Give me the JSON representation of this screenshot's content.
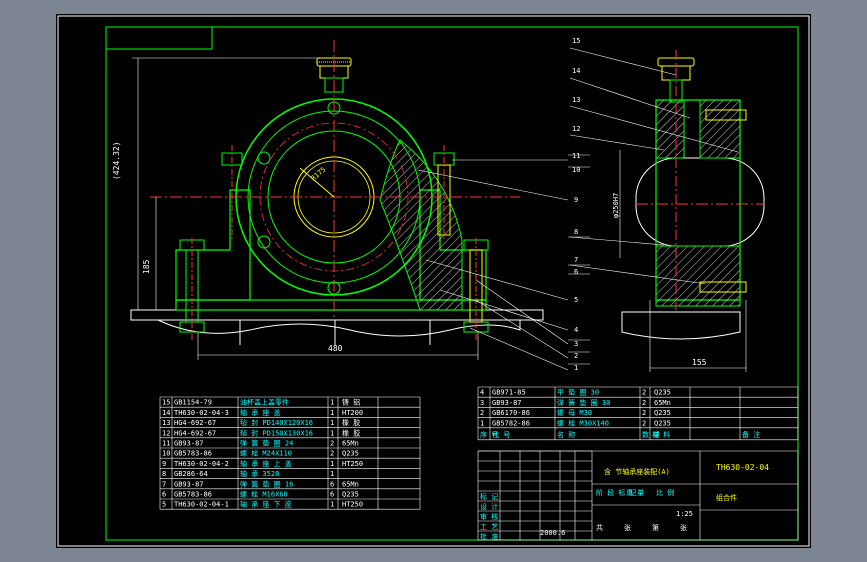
{
  "drawing": {
    "dims": {
      "overall_height": "(424.32)",
      "center_height": "185",
      "base_width": "480",
      "bore_radius": "R175",
      "shaft_dia": "φ250H7",
      "right_offset": "155"
    },
    "balloons_left": [
      "11",
      "10",
      "9",
      "8",
      "7",
      "6",
      "5",
      "4",
      "3",
      "2",
      "1"
    ],
    "balloons_right": [
      "15",
      "14",
      "13",
      "12"
    ],
    "leader_num_extra": "11",
    "parts_table_left": [
      [
        "15",
        "GB1154-79",
        "油杯盖上盖零件",
        "1",
        "铸 铝",
        ""
      ],
      [
        "14",
        "TH630-02-04-3",
        "轴 承 座 盖",
        "1",
        "HT200",
        ""
      ],
      [
        "13",
        "HG4-692-67",
        "毡 封 PD140X120X16",
        "1",
        "橡 胶",
        ""
      ],
      [
        "12",
        "HG4-692-67",
        "毡 封 PD150X130X16",
        "1",
        "橡 胶",
        ""
      ],
      [
        "11",
        "GB93-87",
        "弹 簧 垫 圈  24",
        "2",
        "65Mn",
        ""
      ],
      [
        "10",
        "GB5783-86",
        "螺 栓  M24X110",
        "2",
        "Q235",
        ""
      ],
      [
        "9",
        "TH630-02-04-2",
        "轴 承 座 上 盖",
        "1",
        "HT250",
        ""
      ],
      [
        "8",
        "GB286-64",
        "轴 承  3528",
        "1",
        "",
        ""
      ],
      [
        "7",
        "GB93-87",
        "弹 簧 垫 圈  16",
        "6",
        "65Mn",
        ""
      ],
      [
        "6",
        "GB5783-86",
        "螺 栓  M16X60",
        "6",
        "Q235",
        ""
      ],
      [
        "5",
        "TH630-02-04-1",
        "轴 承 座 下 座",
        "1",
        "HT250",
        ""
      ]
    ],
    "parts_table_right": [
      [
        "4",
        "GB971-85",
        "平 垫 圈  30",
        "2",
        "Q235",
        ""
      ],
      [
        "3",
        "GB93-87",
        "弹 簧 垫 圈  30",
        "2",
        "65Mn",
        ""
      ],
      [
        "2",
        "GB6170-86",
        "螺 母  M30",
        "2",
        "Q235",
        ""
      ],
      [
        "1",
        "GB5782-86",
        "螺 栓  M30X140",
        "2",
        "Q235",
        ""
      ]
    ],
    "header_row": [
      "序 号",
      "代 号",
      "名 称",
      "数 量",
      "材 料",
      "备 注"
    ],
    "title_block": {
      "title": "含 节轴承座装配(A)",
      "drawing_no": "TH630-02-04",
      "unit_label": "组合件",
      "scale": "1:25",
      "date": "2000.6",
      "left_labels": [
        "标 记",
        "设 计",
        "审 核",
        "工 艺",
        "批 准"
      ],
      "mid_labels": [
        "阶 段 标 记",
        "重 量",
        "比 例"
      ],
      "sheet": [
        "共",
        "张",
        "第",
        "张"
      ]
    }
  }
}
